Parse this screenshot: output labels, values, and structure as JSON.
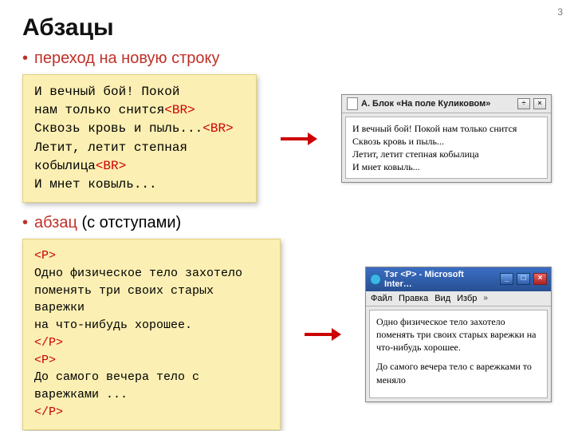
{
  "page_number": "3",
  "title": "Абзацы",
  "bullets": {
    "b1": "переход на новую строку",
    "b2a": "абзац",
    "b2b": " (с отступами)"
  },
  "code1": {
    "l1": "И вечный бой! Покой",
    "l2a": "нам только снится",
    "l2b": "<BR>",
    "l3a": "Сквозь кровь и пыль...",
    "l3b": "<BR>",
    "l4": "Летит, летит степная",
    "l5a": "кобылица",
    "l5b": "<BR>",
    "l6": "И мнет ковыль..."
  },
  "code2": {
    "t1": "<P>",
    "l1": "Одно физическое тело захотело",
    "l2": "поменять три своих старых варежки",
    "l3": "на что-нибудь хорошее.",
    "t2": "</P>",
    "t3": "<P>",
    "l4": "До самого вечера тело с",
    "l5": "варежками ...",
    "t4": "</P>"
  },
  "win1": {
    "title": "А. Блок «На поле Куликовом»",
    "btn_min": "÷",
    "btn_close": "×",
    "body_l1": "И вечный бой! Покой нам только снится",
    "body_l2": "Сквозь кровь и пыль...",
    "body_l3": "Летит, летит степная кобылица",
    "body_l4": "И мнет ковыль..."
  },
  "win2": {
    "title": "Тэг <P> - Microsoft Inter…",
    "btn_min": "_",
    "btn_max": "□",
    "btn_close": "×",
    "menu1": "Файл",
    "menu2": "Правка",
    "menu3": "Вид",
    "menu4": "Избр",
    "chev": "»",
    "p1": "Одно физическое тело захотело поменять три своих старых варежки на что-нибудь хорошее.",
    "p2": "До самого вечера тело с варежками то меняло"
  }
}
